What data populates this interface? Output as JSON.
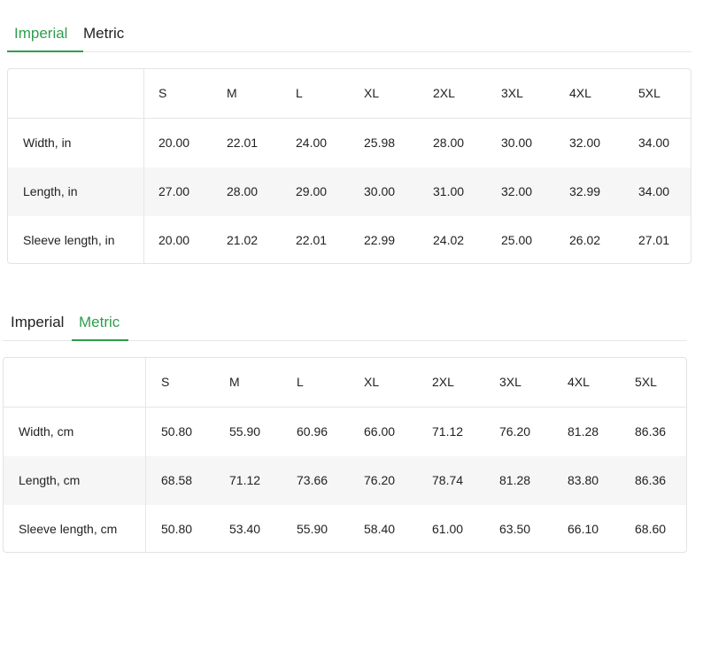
{
  "sections": [
    {
      "tabs": [
        {
          "label": "Imperial",
          "active": true
        },
        {
          "label": "Metric",
          "active": false
        }
      ],
      "columns": [
        "S",
        "M",
        "L",
        "XL",
        "2XL",
        "3XL",
        "4XL",
        "5XL"
      ],
      "rows": [
        {
          "label": "Width, in",
          "values": [
            "20.00",
            "22.01",
            "24.00",
            "25.98",
            "28.00",
            "30.00",
            "32.00",
            "34.00"
          ]
        },
        {
          "label": "Length, in",
          "values": [
            "27.00",
            "28.00",
            "29.00",
            "30.00",
            "31.00",
            "32.00",
            "32.99",
            "34.00"
          ]
        },
        {
          "label": "Sleeve length, in",
          "values": [
            "20.00",
            "21.02",
            "22.01",
            "22.99",
            "24.02",
            "25.00",
            "26.02",
            "27.01"
          ]
        }
      ]
    },
    {
      "tabs": [
        {
          "label": "Imperial",
          "active": false
        },
        {
          "label": "Metric",
          "active": true
        }
      ],
      "columns": [
        "S",
        "M",
        "L",
        "XL",
        "2XL",
        "3XL",
        "4XL",
        "5XL"
      ],
      "rows": [
        {
          "label": "Width, cm",
          "values": [
            "50.80",
            "55.90",
            "60.96",
            "66.00",
            "71.12",
            "76.20",
            "81.28",
            "86.36"
          ]
        },
        {
          "label": "Length, cm",
          "values": [
            "68.58",
            "71.12",
            "73.66",
            "76.20",
            "78.74",
            "81.28",
            "83.80",
            "86.36"
          ]
        },
        {
          "label": "Sleeve length, cm",
          "values": [
            "50.80",
            "53.40",
            "55.90",
            "58.40",
            "61.00",
            "63.50",
            "66.10",
            "68.60"
          ]
        }
      ]
    }
  ],
  "colors": {
    "accent": "#2e9e4d",
    "border": "#e3e3e3",
    "stripe": "#f6f6f6",
    "text": "#222222"
  }
}
